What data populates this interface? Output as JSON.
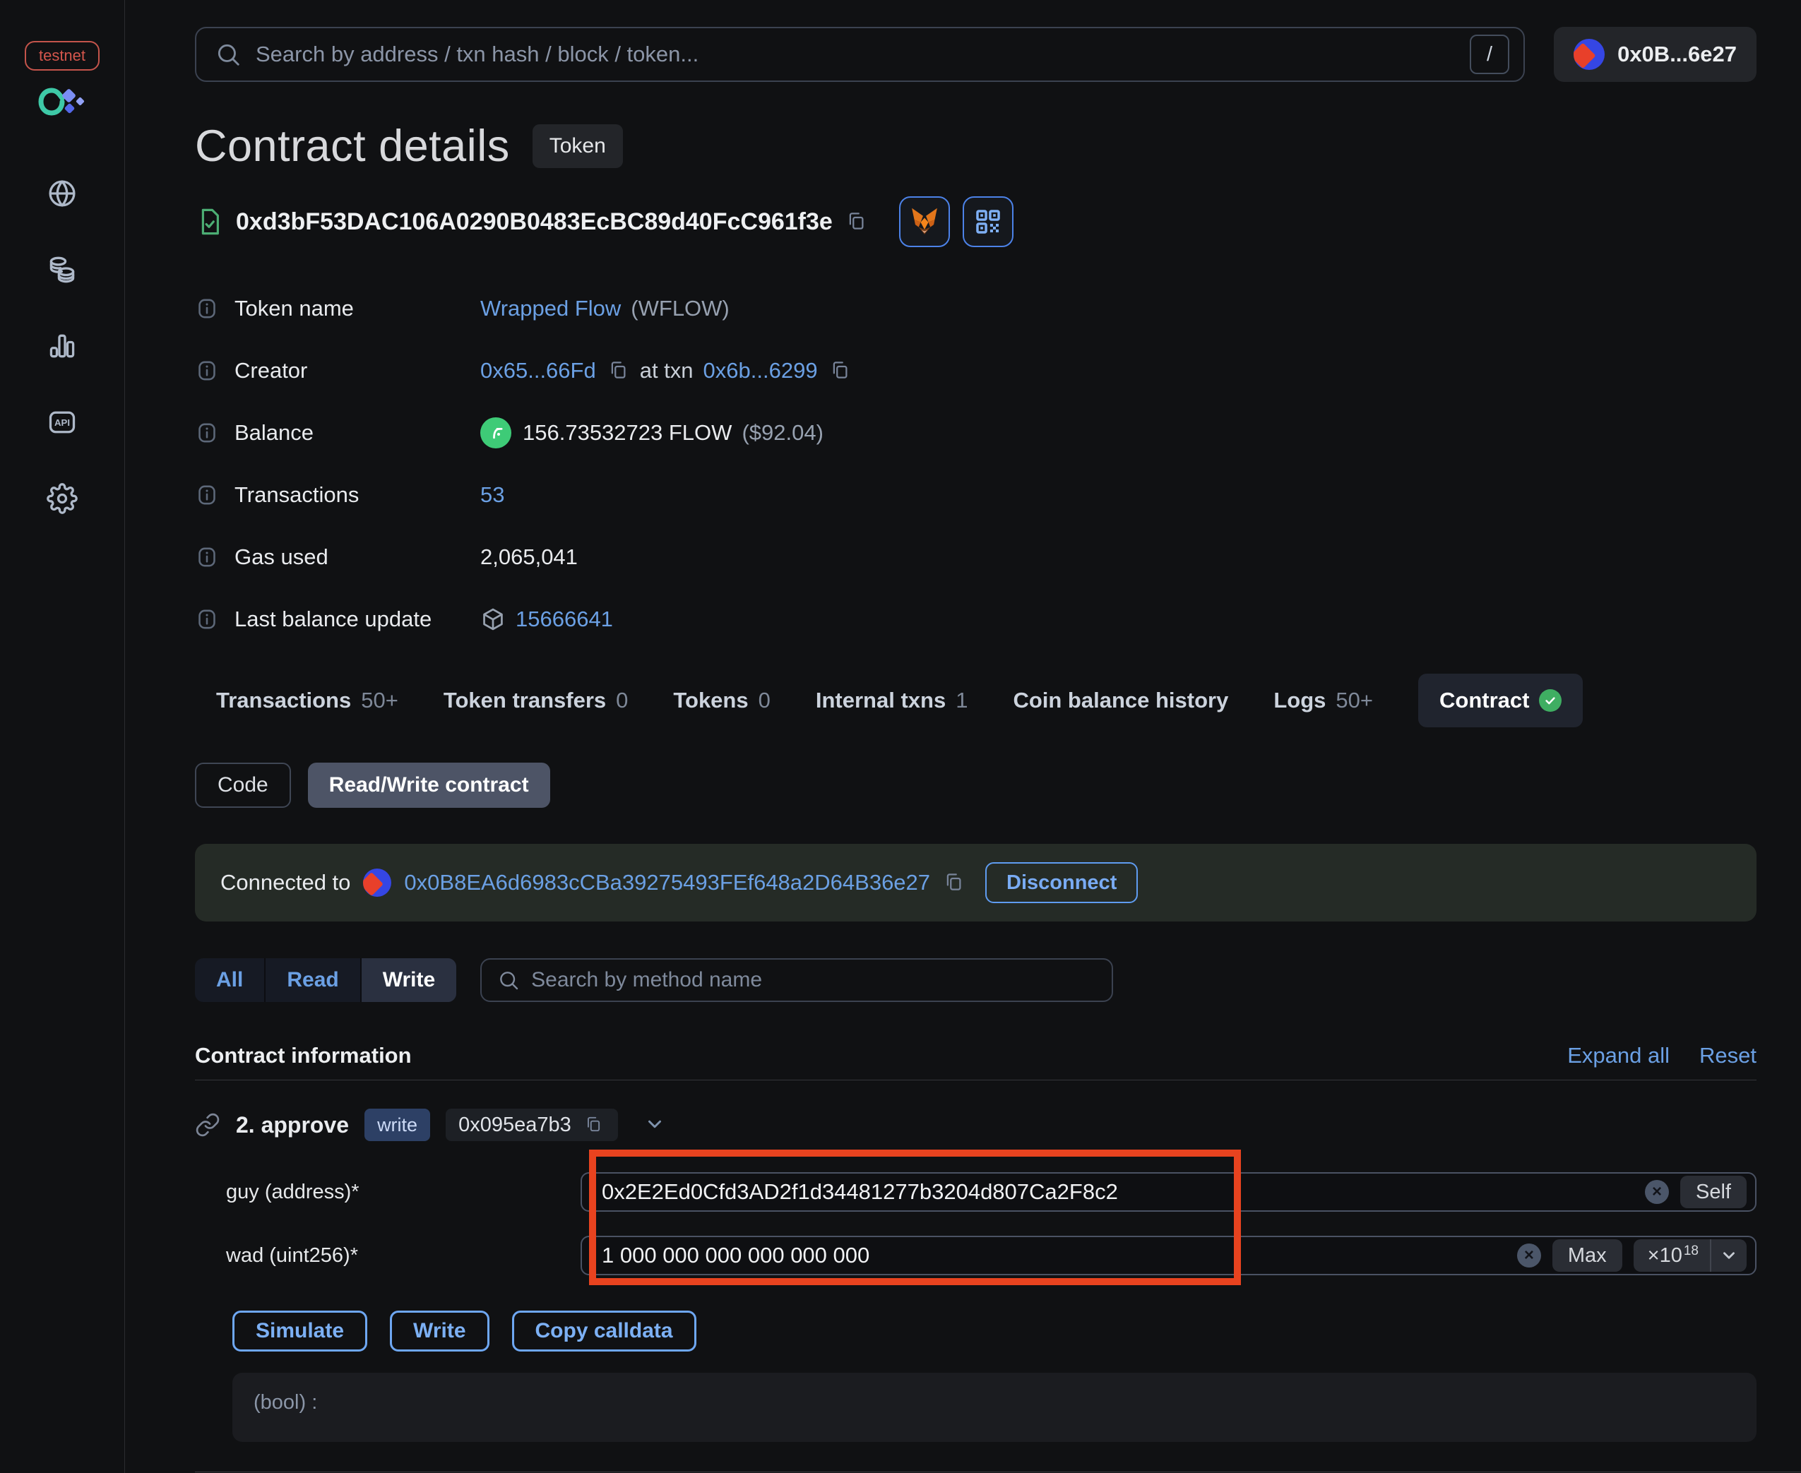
{
  "colors": {
    "link_blue": "#6ba0e4",
    "accent_blue": "#79abf3",
    "highlight_orange": "#e8431f",
    "success_green": "#3fae62",
    "testnet_red": "#d4564c",
    "write_badge_bg": "#2d4065",
    "banner_bg": "#252b26"
  },
  "sidebar": {
    "env_badge": "testnet",
    "api_label": "API",
    "icons": [
      "app-logo-icon",
      "globe-icon",
      "tokens-icon",
      "stats-icon",
      "api-icon",
      "settings-icon"
    ]
  },
  "topbar": {
    "search_placeholder": "Search by address / txn hash / block / token...",
    "shortcut_key": "/",
    "wallet_label": "0x0B...6e27"
  },
  "page": {
    "title": "Contract details",
    "type_badge": "Token",
    "contract_address": "0xd3bF53DAC106A0290B0483EcBC89d40FcC961f3e"
  },
  "info": {
    "token_name": {
      "label": "Token name",
      "link": "Wrapped Flow",
      "symbol": "(WFLOW)"
    },
    "creator": {
      "label": "Creator",
      "address": "0x65...66Fd",
      "at_txn": "at txn",
      "txn": "0x6b...6299"
    },
    "balance": {
      "label": "Balance",
      "amount": "156.73532723 FLOW",
      "usd": "($92.04)"
    },
    "transactions": {
      "label": "Transactions",
      "count": "53"
    },
    "gas_used": {
      "label": "Gas used",
      "value": "2,065,041"
    },
    "last_balance_update": {
      "label": "Last balance update",
      "block": "15666641"
    }
  },
  "tabs": [
    {
      "label": "Transactions",
      "count": "50+"
    },
    {
      "label": "Token transfers",
      "count": "0"
    },
    {
      "label": "Tokens",
      "count": "0"
    },
    {
      "label": "Internal txns",
      "count": "1"
    },
    {
      "label": "Coin balance history",
      "count": ""
    },
    {
      "label": "Logs",
      "count": "50+"
    },
    {
      "label": "Contract",
      "count": "",
      "active": true
    }
  ],
  "subtabs": {
    "code": "Code",
    "read_write": "Read/Write contract"
  },
  "connection": {
    "prefix": "Connected to",
    "address": "0x0B8EA6d6983cCBa39275493FEf648a2D64B36e27",
    "disconnect": "Disconnect"
  },
  "method_filter": {
    "all": "All",
    "read": "Read",
    "write": "Write",
    "active": "Write",
    "search_placeholder": "Search by method name"
  },
  "section": {
    "title": "Contract information",
    "expand_all": "Expand all",
    "reset": "Reset"
  },
  "method": {
    "name": "2. approve",
    "badge": "write",
    "selector": "0x095ea7b3",
    "params": [
      {
        "label": "guy (address)*",
        "value": "0x2E2Ed0Cfd3AD2f1d34481277b3204d807Ca2F8c2",
        "action": "Self"
      },
      {
        "label": "wad (uint256)*",
        "value": "1 000 000 000 000 000 000",
        "action": "Max",
        "multiplier": "×10",
        "exponent": "18"
      }
    ],
    "actions": {
      "simulate": "Simulate",
      "write": "Write",
      "copy_calldata": "Copy calldata"
    },
    "output_placeholder": "(bool) :"
  }
}
